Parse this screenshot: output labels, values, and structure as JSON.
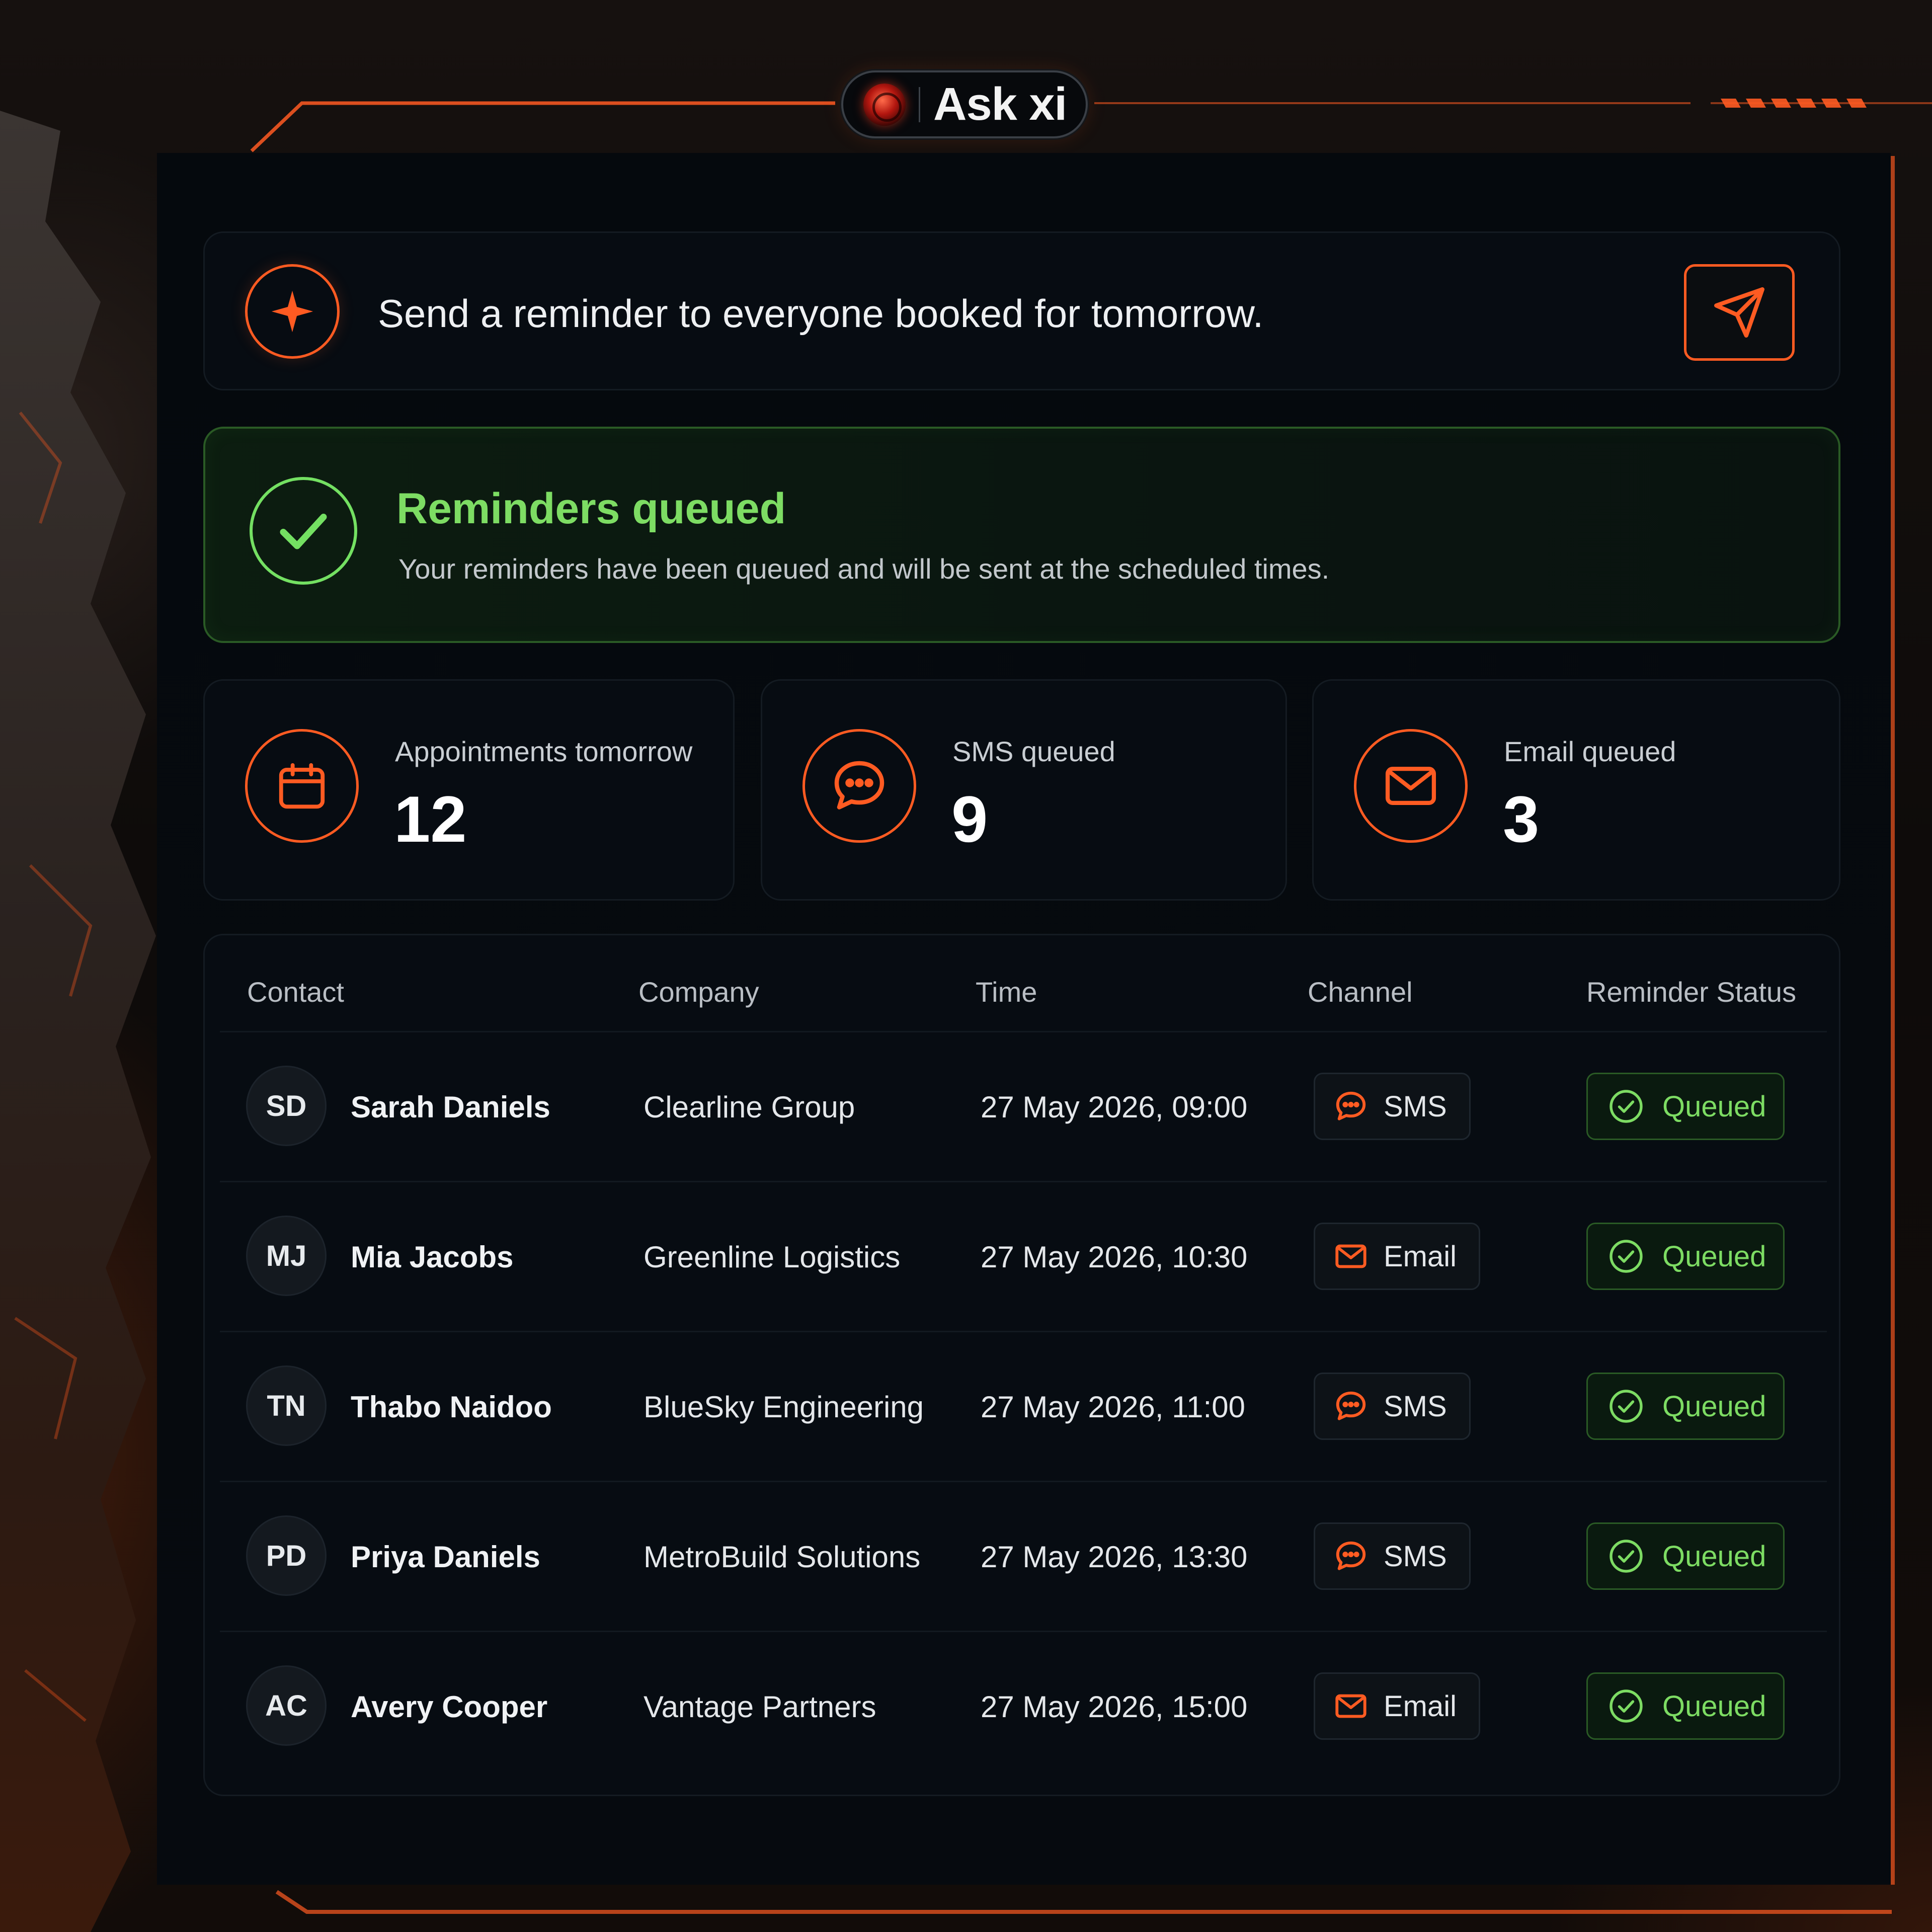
{
  "brand": {
    "name": "Ask xi"
  },
  "colors": {
    "accent": "#ff5b22",
    "success": "#7ddc63",
    "panel": "#05090d"
  },
  "prompt": {
    "text": "Send a reminder to everyone booked for tomorrow.",
    "icon": "sparkle-icon",
    "send_icon": "send-icon"
  },
  "success": {
    "title": "Reminders queued",
    "description": "Your reminders have been queued and will be sent at the scheduled times.",
    "icon": "check-icon"
  },
  "stats": [
    {
      "label": "Appointments tomorrow",
      "value": "12",
      "icon": "calendar-icon"
    },
    {
      "label": "SMS queued",
      "value": "9",
      "icon": "chat-icon"
    },
    {
      "label": "Email queued",
      "value": "3",
      "icon": "mail-icon"
    }
  ],
  "table": {
    "headers": [
      "Contact",
      "Company",
      "Time",
      "Channel",
      "Reminder Status"
    ],
    "rows": [
      {
        "initials": "SD",
        "name": "Sarah Daniels",
        "company": "Clearline Group",
        "time": "27 May 2026, 09:00",
        "channel": "SMS",
        "status": "Queued"
      },
      {
        "initials": "MJ",
        "name": "Mia Jacobs",
        "company": "Greenline Logistics",
        "time": "27 May 2026, 10:30",
        "channel": "Email",
        "status": "Queued"
      },
      {
        "initials": "TN",
        "name": "Thabo Naidoo",
        "company": "BlueSky Engineering",
        "time": "27 May 2026, 11:00",
        "channel": "SMS",
        "status": "Queued"
      },
      {
        "initials": "PD",
        "name": "Priya Daniels",
        "company": "MetroBuild Solutions",
        "time": "27 May 2026, 13:30",
        "channel": "SMS",
        "status": "Queued"
      },
      {
        "initials": "AC",
        "name": "Avery Cooper",
        "company": "Vantage Partners",
        "time": "27 May 2026, 15:00",
        "channel": "Email",
        "status": "Queued"
      }
    ]
  }
}
